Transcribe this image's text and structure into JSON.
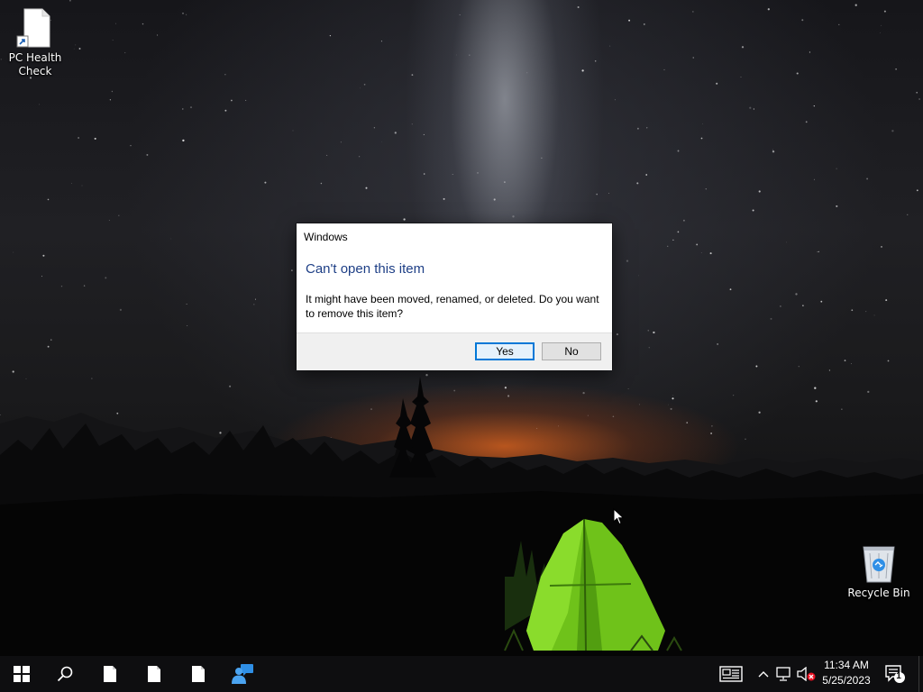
{
  "desktop": {
    "icons": [
      {
        "label": "PC Health Check",
        "icon": "shortcut-file-icon"
      },
      {
        "label": "Recycle Bin",
        "icon": "recycle-bin-icon"
      }
    ]
  },
  "dialog": {
    "title": "Windows",
    "heading": "Can't open this item",
    "message": "It might have been moved, renamed, or deleted. Do you want to remove this item?",
    "yes_label": "Yes",
    "no_label": "No",
    "accent_color": "#0078d7",
    "heading_color": "#1e3f86"
  },
  "taskbar": {
    "background_color": "#0e0e10",
    "pinned": [
      {
        "icon": "windows-logo-icon"
      },
      {
        "icon": "search-icon"
      },
      {
        "icon": "file-icon"
      },
      {
        "icon": "file-icon"
      },
      {
        "icon": "file-icon"
      },
      {
        "icon": "quick-assist-icon"
      }
    ],
    "tray": {
      "icons": [
        "news-icon",
        "chevron-up-icon",
        "network-icon",
        "volume-muted-icon",
        "notification-icon"
      ],
      "time": "11:34 AM",
      "date": "5/25/2023",
      "notification_count": "1"
    }
  }
}
